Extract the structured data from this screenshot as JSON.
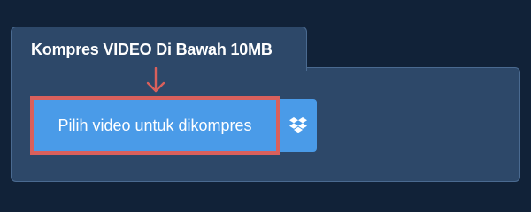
{
  "panel": {
    "tab_title": "Kompres VIDEO Di Bawah 10MB"
  },
  "upload": {
    "select_label": "Pilih video untuk dikompres",
    "dropbox_icon": "dropbox-icon",
    "hint_arrow_icon": "arrow-down-icon"
  },
  "colors": {
    "background": "#112238",
    "panel": "#2d4869",
    "button": "#4a9be8",
    "highlight": "#d9605c",
    "text": "#ffffff"
  }
}
